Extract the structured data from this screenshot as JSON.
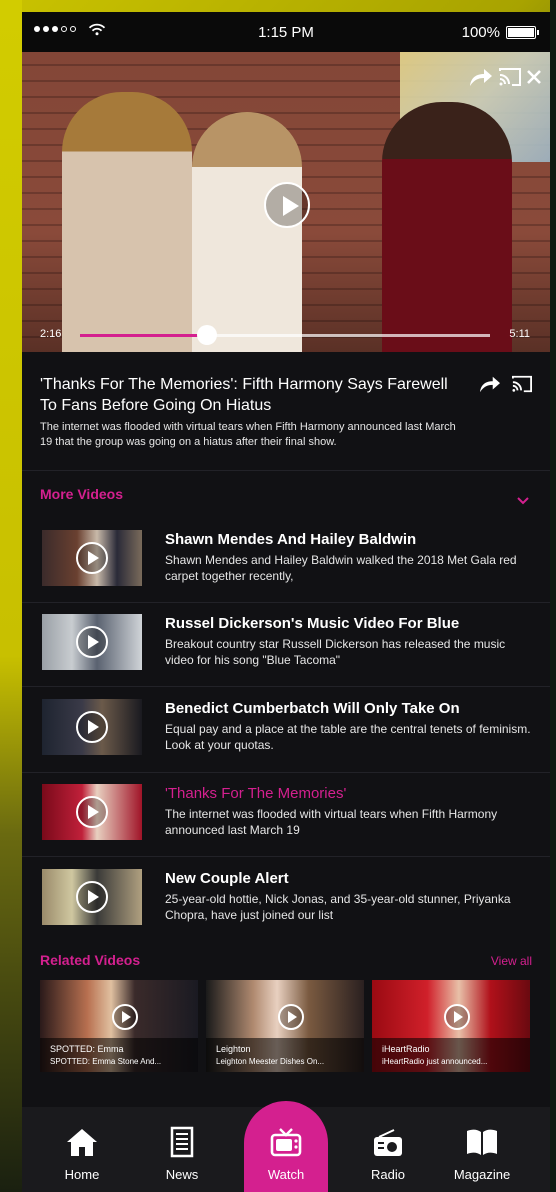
{
  "status_bar": {
    "time": "1:15 PM",
    "battery": "100%"
  },
  "player": {
    "current_time": "2:16",
    "total_time": "5:11",
    "progress": 0.31
  },
  "article": {
    "title": "'Thanks For The Memories': Fifth Harmony Says Farewell To Fans Before Going On Hiatus",
    "description": "The internet was flooded with virtual tears when Fifth Harmony announced last March 19 that the group was going on a hiatus after their final show."
  },
  "more_videos": {
    "heading": "More Videos",
    "items": [
      {
        "title": "Shawn Mendes And Hailey Baldwin",
        "desc": "Shawn Mendes and Hailey Baldwin walked the 2018 Met Gala red carpet together recently,",
        "active": false
      },
      {
        "title": "Russel Dickerson's Music Video For Blue",
        "desc": "Breakout country star Russell Dickerson has released the music video for his song \"Blue Tacoma\"",
        "active": false
      },
      {
        "title": "Benedict Cumberbatch Will Only Take On",
        "desc": "Equal pay and a place at the table are the central tenets of feminism. Look at your quotas.",
        "active": false
      },
      {
        "title": "'Thanks For The Memories'",
        "desc": "The internet was flooded with virtual tears when Fifth Harmony announced last March 19",
        "active": true
      },
      {
        "title": "New Couple Alert",
        "desc": "25-year-old hottie, Nick Jonas, and 35-year-old stunner, Priyanka Chopra, have just joined our list",
        "active": false
      }
    ]
  },
  "related_videos": {
    "heading": "Related Videos",
    "view_all": "View all",
    "items": [
      {
        "line1": "SPOTTED: Emma",
        "line2": "SPOTTED: Emma Stone And..."
      },
      {
        "line1": "Leighton",
        "line2": "Leighton Meester Dishes On..."
      },
      {
        "line1": "iHeartRadio",
        "line2": "iHeartRadio just announced..."
      }
    ]
  },
  "tabs": [
    "Home",
    "News",
    "Watch",
    "Radio",
    "Magazine"
  ],
  "colors": {
    "accent": "#d4208f",
    "background": "#111114"
  }
}
